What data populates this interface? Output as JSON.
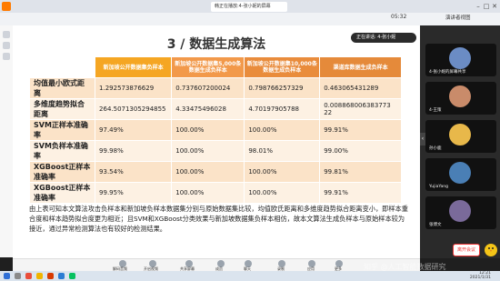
{
  "window": {
    "tab_title": "韩正在播放:4-张小妮的屏幕",
    "minimize": "–",
    "maximize": "□",
    "close": "✕"
  },
  "toolbar": {
    "time": "05:32",
    "right_label": "演讲者视图"
  },
  "slide": {
    "title": "3 / 数据生成算法",
    "share_status": "正在讲话: 4-张小妮",
    "table": {
      "headers": [
        "",
        "新加坡公开数据集负样本",
        "新加坡公开数据集5,000条数据生成负样本",
        "新加坡公开数据集10,000条数据生成负样本",
        "渠道库数据生成负样本"
      ],
      "rows": [
        {
          "label": "均值最小欧式距离",
          "values": [
            "1.292573876629",
            "0.737607200024",
            "0.798766257329",
            "0.463065431289"
          ]
        },
        {
          "label": "多维度趋势拟合距离",
          "values": [
            "264.5071305294855",
            "4.33475496028",
            "4.70197905788",
            "0.008868006383773 22"
          ]
        },
        {
          "label": "SVM正样本准确率",
          "values": [
            "97.49%",
            "100.00%",
            "100.00%",
            "99.91%"
          ]
        },
        {
          "label": "SVM负样本准确率",
          "values": [
            "99.98%",
            "100.00%",
            "98.01%",
            "99.00%"
          ]
        },
        {
          "label": "XGBoost正样本准确率",
          "values": [
            "93.54%",
            "100.00%",
            "100.00%",
            "99.81%"
          ]
        },
        {
          "label": "XGBoost正样本准确率",
          "values": [
            "99.95%",
            "100.00%",
            "100.00%",
            "99.91%"
          ]
        }
      ]
    },
    "paragraph": "由上表可知本文算法攻击负样本和新加坡负样本数据集分别与原始数据集比较，均值欧氏距离和多维度趋势拟合距离变小，即样本重合度和样本趋势拟合度更为相近；且SVM和XGBoost分类效果与新加坡数据集负样本相仿，故本文算法生成负样本与原始样本较为接近，通过异常检测算法也有较好的检测结果。"
  },
  "bottom_toolbar": {
    "items": [
      "解码音频",
      "开启视频",
      "共享屏幕",
      "成员",
      "聊天",
      "录制",
      "应用",
      "更多"
    ]
  },
  "participants": [
    {
      "name": "4-张小妮的屏幕共享",
      "color": "#6b8cc4"
    },
    {
      "name": "4-王策",
      "color": "#c98b6a"
    },
    {
      "name": "孙小鹿",
      "color": "#e8b84a"
    },
    {
      "name": "YujiaYang",
      "color": "#4a7fb5"
    },
    {
      "name": "张博文",
      "color": "#7a6a9a"
    }
  ],
  "right_panel": {
    "exit_label": "离开会议"
  },
  "taskbar": {
    "clock_time": "12:21",
    "clock_date": "2021/1/31"
  },
  "watermark": "知乎 @人工智能数据研究"
}
